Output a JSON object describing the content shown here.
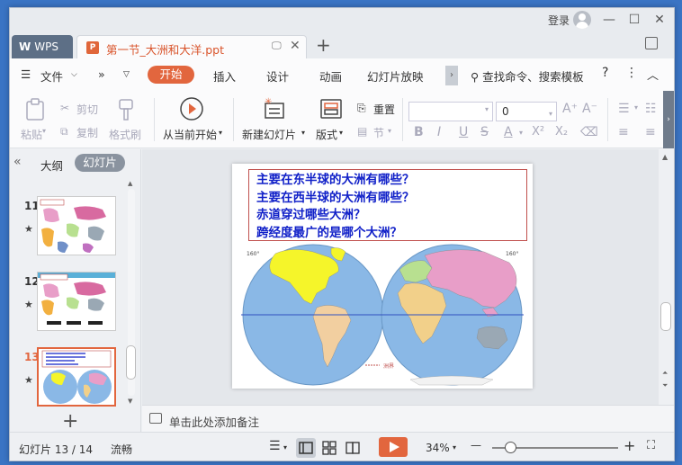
{
  "titlebar": {
    "login_label": "登录",
    "min": "—",
    "max": "☐",
    "close": "✕"
  },
  "tabs": {
    "app_tab": "WPS",
    "app_logo": "W",
    "doc_tab_title": "第一节_大洲和大洋.ppt",
    "doc_icon": "P",
    "doc_close": "✕",
    "new_tab": "+"
  },
  "menu": {
    "file": "文件",
    "items": [
      {
        "label": "开始",
        "active": true
      },
      {
        "label": "插入"
      },
      {
        "label": "设计"
      },
      {
        "label": "动画"
      },
      {
        "label": "幻灯片放映"
      }
    ],
    "search_placeholder": "查找命令、搜索模板"
  },
  "ribbon": {
    "paste": "粘贴",
    "cut": "剪切",
    "copy": "复制",
    "format_painter": "格式刷",
    "from_current": "从当前开始",
    "new_slide": "新建幻灯片",
    "layout": "版式",
    "reset": "重置",
    "section": "节",
    "font_size_value": "0",
    "font_buttons": [
      "B",
      "I",
      "U",
      "S",
      "A",
      "X²",
      "X₂"
    ]
  },
  "left_panel": {
    "outline_tab": "大纲",
    "slides_tab": "幻灯片",
    "thumbnails": [
      {
        "number": "11",
        "current": false,
        "star": "★"
      },
      {
        "number": "12",
        "current": false,
        "star": "★"
      },
      {
        "number": "13",
        "current": true,
        "star": "★"
      }
    ],
    "add_slide": "+"
  },
  "slide": {
    "questions": [
      "主要在东半球的大洲有哪些？",
      "主要在西半球的大洲有哪些？",
      "赤道穿过哪些大洲？",
      "跨经度最广的是哪个大洲？"
    ],
    "map_labels": {
      "west_lon": "160°",
      "east_lon": "160°",
      "legend": "洲界"
    },
    "colors": {
      "ocean": "#8ab8e6",
      "north_america": "#f5f52a",
      "south_america": "#f2cfa0",
      "asia": "#e89ec8",
      "europe": "#b8e090",
      "africa": "#f2d08a",
      "oceania": "#9aa8b4",
      "antarctica": "#f2f2f2",
      "equator": "#3050c0"
    }
  },
  "notes": {
    "placeholder": "单击此处添加备注"
  },
  "status": {
    "slide_counter": "幻灯片 13 / 14",
    "theme": "流畅",
    "zoom": "34%",
    "zoom_minus": "—",
    "zoom_plus": "+"
  }
}
